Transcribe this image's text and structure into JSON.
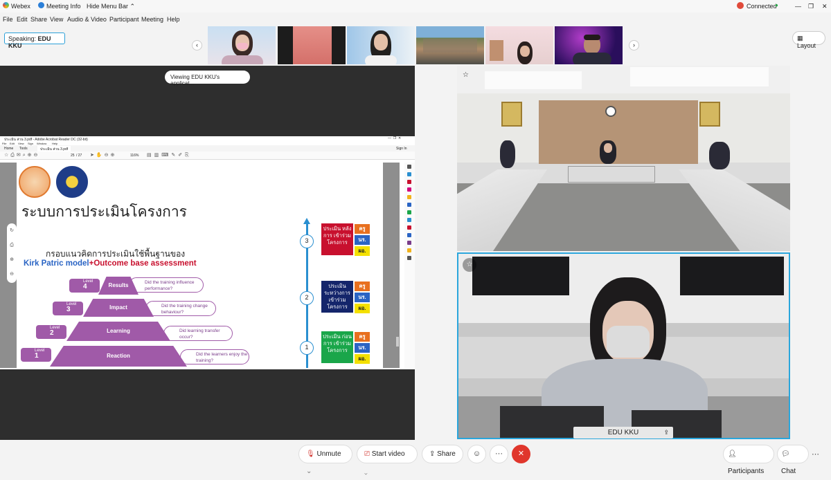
{
  "titlebar": {
    "app": "Webex",
    "meeting_info": "Meeting Info",
    "hide_menu": "Hide Menu Bar",
    "status": "Connected",
    "status_dot": "●"
  },
  "menu": [
    "File",
    "Edit",
    "Share",
    "View",
    "Audio & Video",
    "Participant",
    "Meeting",
    "Help"
  ],
  "speaking": {
    "label": "Speaking:",
    "name": "EDU KKU"
  },
  "layout_label": "Layout",
  "viewing_label": "Viewing EDU KKU's applicat...",
  "reader": {
    "title": "ประเมิน ส่วน 3.pdf - Adobe Acrobat Reader DC (32-bit)",
    "menu": [
      "File",
      "Edit",
      "View",
      "Sign",
      "Window",
      "Help"
    ],
    "tabs": [
      "Home",
      "Tools",
      "ประเมิน ส่วน 3.pdf"
    ],
    "page": "25",
    "pages": "/ 27",
    "zoom": "116%",
    "signin": "Sign In"
  },
  "slide": {
    "title": "ระบบการประเมินโครงการ",
    "subtitle": "กรอบแนวคิดการประเมินใช้พื้นฐานของ",
    "model_blue": "Kirk Patric model",
    "model_plus": "+",
    "model_red": "Outcome base assessment",
    "levels": [
      {
        "word": "Level",
        "num": "4",
        "name": "Results",
        "question": "Did the training influence performance?"
      },
      {
        "word": "Level",
        "num": "3",
        "name": "Impact",
        "question": "Did the training change behaviour?"
      },
      {
        "word": "Level",
        "num": "2",
        "name": "Learning",
        "question": "Did learning transfer occur?"
      },
      {
        "word": "Level",
        "num": "1",
        "name": "Reaction",
        "question": "Did the learners enjoy the training?"
      }
    ],
    "stages": [
      {
        "num": "3",
        "text": "ประเมิน หลังการ เข้าร่วม โครงการ",
        "color": "#c8102e"
      },
      {
        "num": "2",
        "text": "ประเมิน ระหว่างการ เข้าร่วม โครงการ",
        "color": "#14256b"
      },
      {
        "num": "1",
        "text": "ประเมิน ก่อนการ เข้าร่วม โครงการ",
        "color": "#1aa64a"
      }
    ],
    "tags": [
      {
        "text": "ครู",
        "color": "#e8701f"
      },
      {
        "text": "นร.",
        "color": "#2b64c4"
      },
      {
        "text": "ผอ.",
        "color": "#f4e000"
      }
    ]
  },
  "video_name": "EDU KKU",
  "controls": {
    "unmute": "Unmute",
    "start_video": "Start video",
    "share": "Share",
    "more": "···",
    "participants": "Participants",
    "chat": "Chat"
  }
}
